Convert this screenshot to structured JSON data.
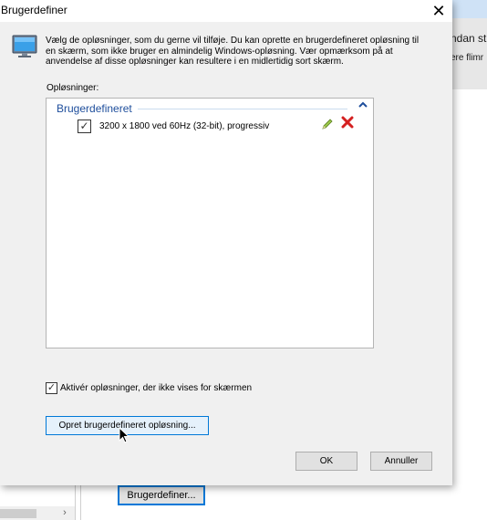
{
  "background_window": {
    "header_text": "ndan st",
    "subtext": "ere flimr",
    "scroll_arrow": "›",
    "button_label": "Brugerdefiner..."
  },
  "dialog": {
    "title": "Brugerdefiner",
    "close_label": "✕",
    "intro": "Vælg de opløsninger, som du gerne vil tilføje. Du kan oprette en brugerdefineret opløsning til en skærm, som ikke bruger en almindelig Windows-opløsning. Vær opmærksom på at anvendelse af disse opløsninger kan resultere i en midlertidig sort skærm.",
    "list_label": "Opløsninger:",
    "group": {
      "name": "Brugerdefineret",
      "chevron": "^"
    },
    "resolutions": [
      {
        "label": "3200 x 1800 ved 60Hz (32-bit), progressiv",
        "checked": true,
        "check_glyph": "✓"
      }
    ],
    "enable_checkbox": {
      "label": "Aktivér opløsninger, der ikke vises for skærmen",
      "checked": true,
      "check_glyph": "✓"
    },
    "create_button": "Opret brugerdefineret opløsning...",
    "ok_button": "OK",
    "cancel_button": "Annuller"
  },
  "icons": {
    "monitor": "monitor-icon",
    "edit": "pencil-icon",
    "delete": "delete-x-icon",
    "cursor": "mouse-cursor"
  },
  "colors": {
    "accent": "#0078d7",
    "group_header": "#1e4e9c",
    "delete": "#d42020",
    "dialog_bg": "#f0f0f0"
  }
}
